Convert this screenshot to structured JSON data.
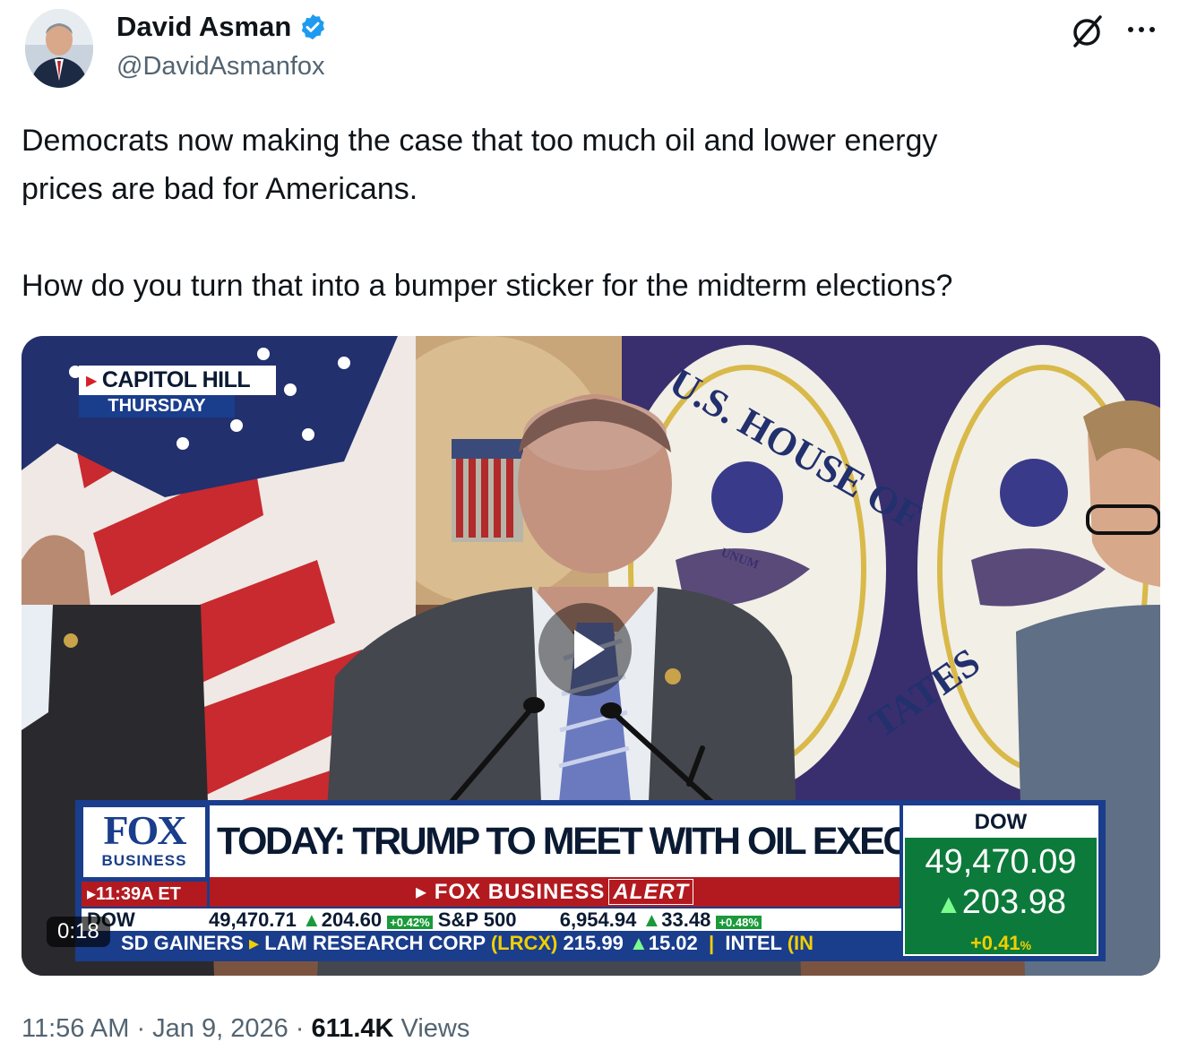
{
  "author": {
    "display_name": "David Asman",
    "handle": "@DavidAsmanfox",
    "verified": true,
    "avatar_icon": "avatar-photo"
  },
  "header_icons": [
    "grok-icon",
    "more-icon"
  ],
  "tweet": {
    "line1": "Democrats now making the case that too much oil and lower energy",
    "line2": "prices are bad for Americans.",
    "line3": "How do you turn that into a bumper sticker for the midterm elections?"
  },
  "video": {
    "duration": "0:18",
    "bug_location": "CAPITOL HILL",
    "bug_day": "THURSDAY",
    "logo_main": "FOX",
    "logo_sub": "BUSINESS",
    "time": "▸11:39A ET",
    "headline": "TODAY: TRUMP TO MEET WITH OIL EXECS AT WHITE HOUSE",
    "alert_brand": "▸ FOX BUSINESS",
    "alert_word": "ALERT",
    "dow_label": "DOW",
    "dow_value": "49,470.09",
    "dow_change": "203.98",
    "dow_pct": "+0.41",
    "dow_pct_unit": "%",
    "ticker1": {
      "dow_label": "DOW",
      "dow_value": "49,470.71",
      "dow_change": "204.60",
      "dow_pct": "+0.42%",
      "sp_label": "S&P 500",
      "sp_value": "6,954.94",
      "sp_change": "33.48",
      "sp_pct": "+0.48%"
    },
    "ticker2": {
      "label": "SD GAINERS",
      "stock1": "LAM RESEARCH CORP",
      "stock1_sym": "(LRCX)",
      "stock1_price": "215.99",
      "stock1_change": "15.02",
      "stock2": "INTEL",
      "stock2_sym": "(IN"
    },
    "background_text": "U.S. HOUSE OF",
    "background_text2": "TATES",
    "seal_word": "UNUM"
  },
  "footer": {
    "time": "11:56 AM",
    "sep1": " · ",
    "date": "Jan 9, 2026",
    "sep2": " · ",
    "views_count": "611.4K",
    "views_label": " Views"
  },
  "colors": {
    "text_primary": "#0f1419",
    "text_secondary": "#536471",
    "verified_blue": "#1d9bf0",
    "fox_blue": "#1a3d8c",
    "fox_red": "#b21a20",
    "dow_green": "#0c7a3a"
  }
}
